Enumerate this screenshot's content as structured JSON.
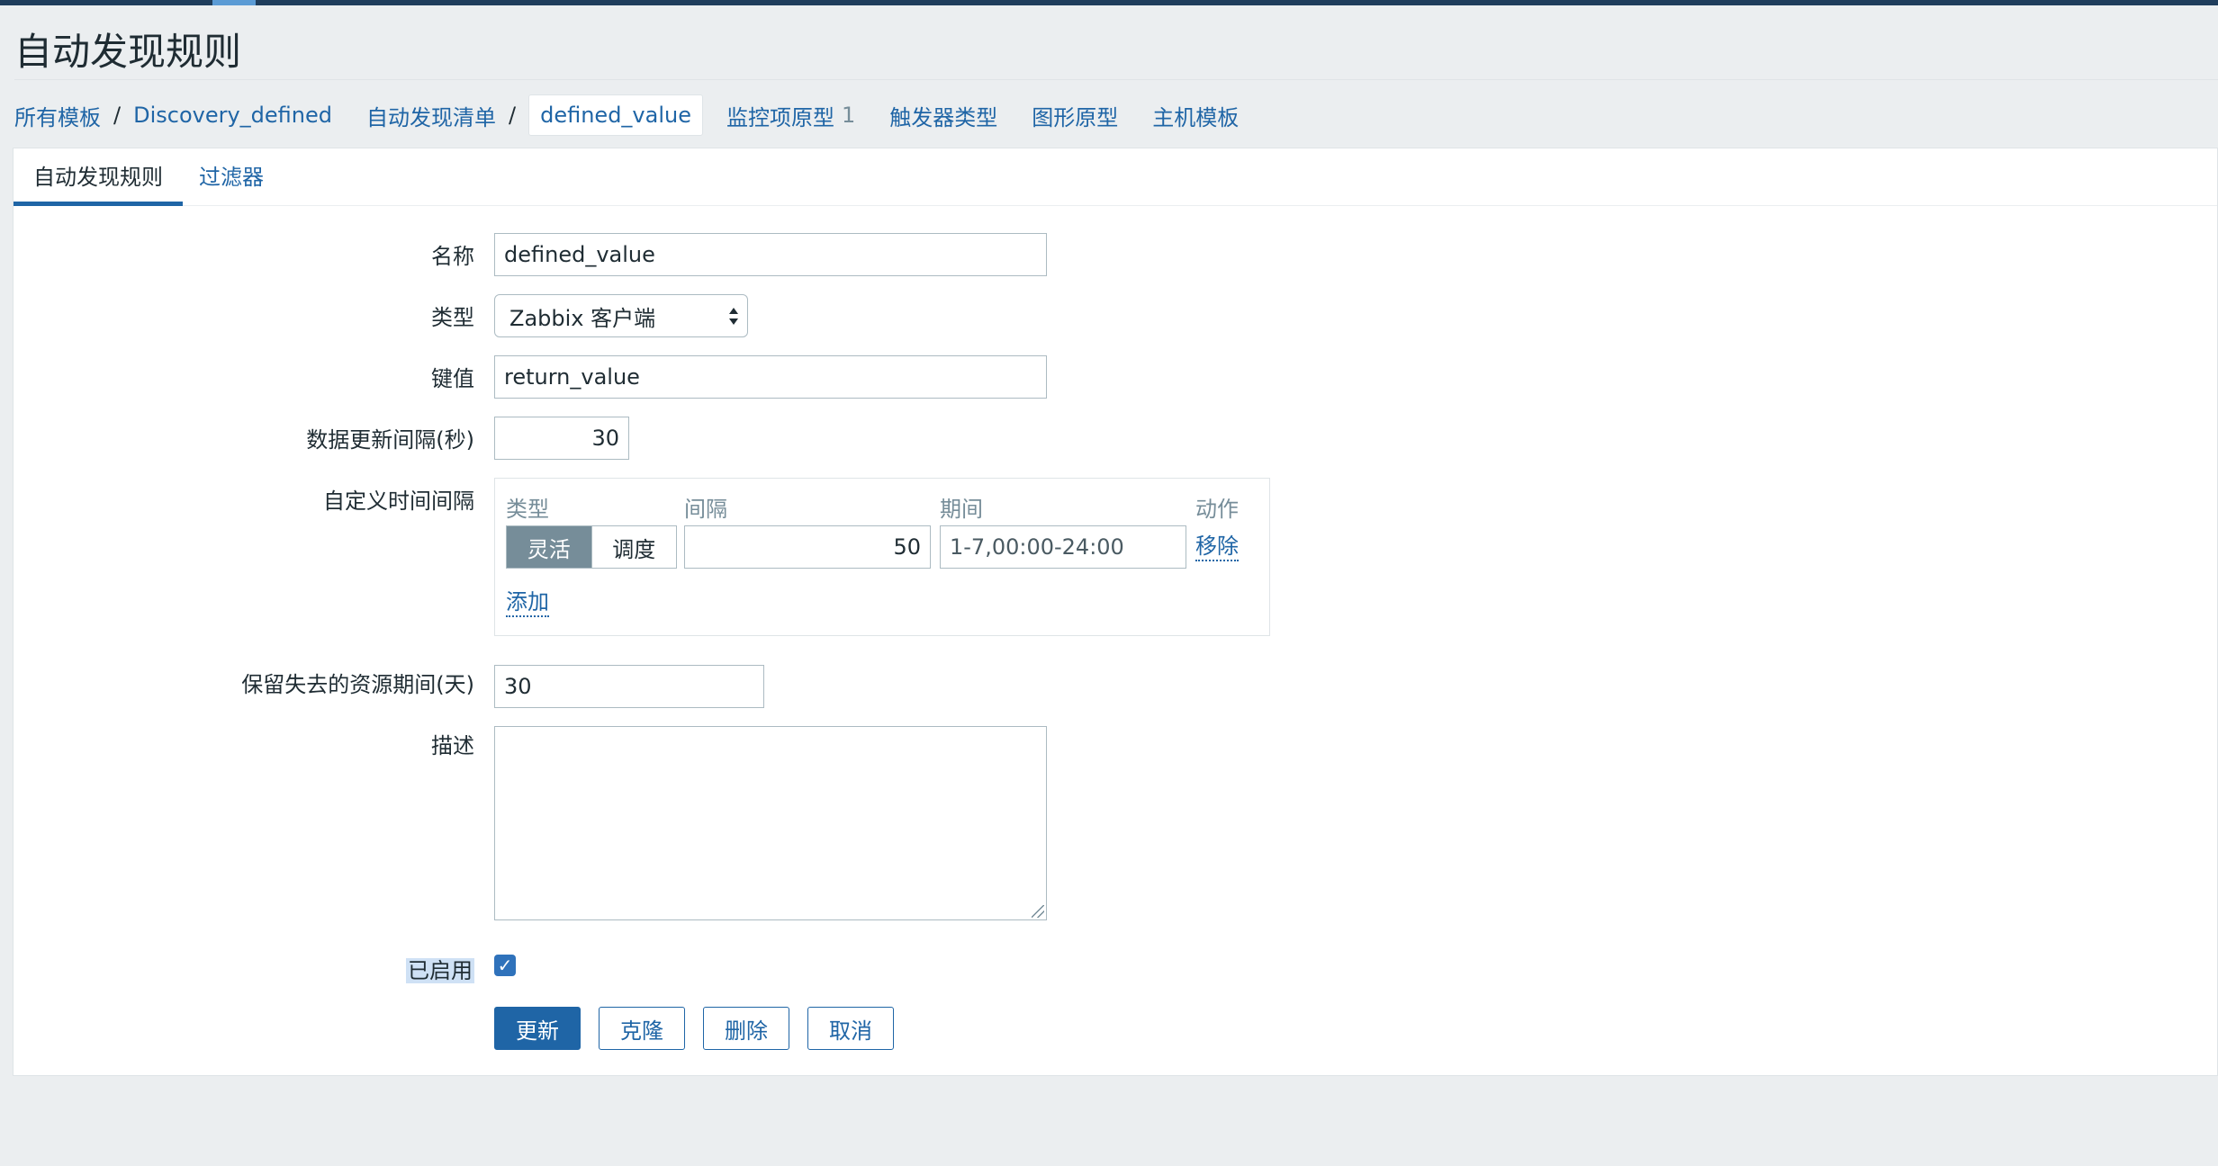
{
  "page": {
    "title": "自动发现规则"
  },
  "breadcrumb": {
    "all_templates": "所有模板",
    "separator": "/",
    "template": "Discovery_defined",
    "discovery_list": "自动发现清单",
    "current_rule": "defined_value",
    "item_prototypes": "监控项原型",
    "item_prototypes_count": "1",
    "trigger_prototypes": "触发器类型",
    "graph_prototypes": "图形原型",
    "host_prototypes": "主机模板"
  },
  "tabs": {
    "rule": "自动发现规则",
    "filter": "过滤器"
  },
  "form": {
    "name_label": "名称",
    "name_value": "defined_value",
    "type_label": "类型",
    "type_value": "Zabbix 客户端",
    "key_label": "键值",
    "key_value": "return_value",
    "interval_label": "数据更新间隔(秒)",
    "interval_value": "30",
    "custom_intervals_label": "自定义时间间隔",
    "custom_intervals": {
      "header_type": "类型",
      "header_interval": "间隔",
      "header_period": "期间",
      "header_action": "动作",
      "type_flexible": "灵活",
      "type_scheduling": "调度",
      "interval_value": "50",
      "period_value": "1-7,00:00-24:00",
      "remove_link": "移除",
      "add_link": "添加"
    },
    "lifetime_label": "保留失去的资源期间(天)",
    "lifetime_value": "30",
    "description_label": "描述",
    "description_value": "",
    "enabled_label": "已启用",
    "enabled_checked": true
  },
  "buttons": {
    "update": "更新",
    "clone": "克隆",
    "delete": "删除",
    "cancel": "取消"
  },
  "colors": {
    "link": "#1f65a6",
    "primary_button": "#1f65a6",
    "header_bar": "#1f3d5c",
    "background": "#ebeef0"
  }
}
